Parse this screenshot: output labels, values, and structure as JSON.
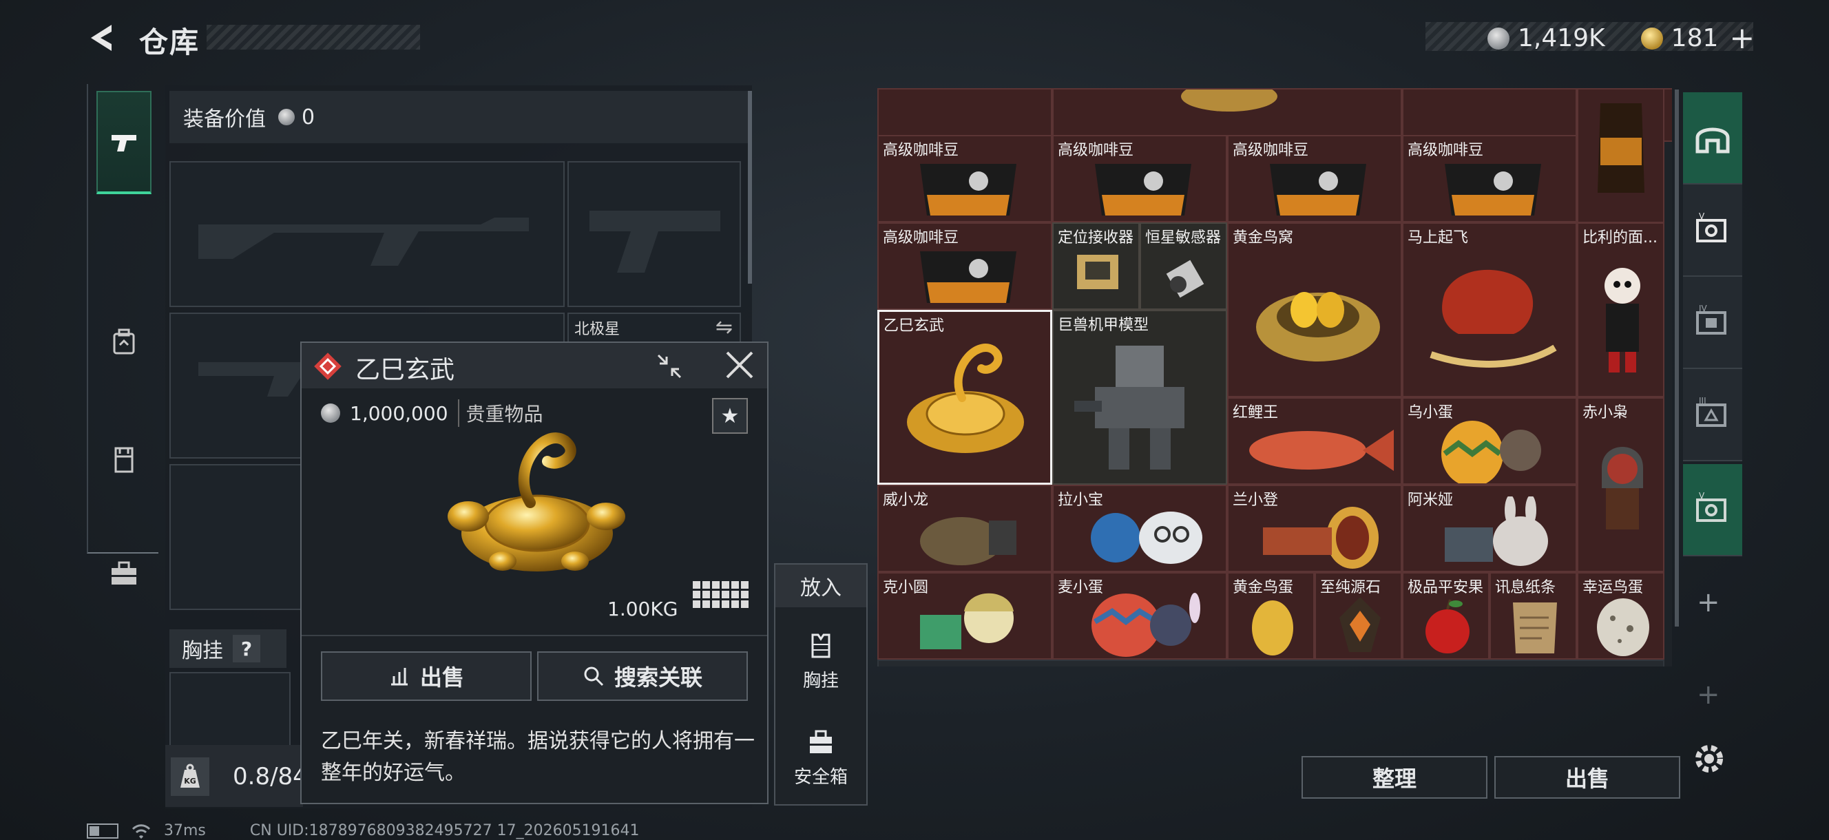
{
  "header": {
    "title": "仓库",
    "back_icon": "back-arrow-icon",
    "silver_amount": "1,419K",
    "gold_amount": "181",
    "add_label": "+"
  },
  "left_rail": {
    "items": [
      {
        "name": "weapons",
        "icon": "pistol-icon",
        "active": true
      },
      {
        "name": "armor",
        "icon": "backpack-icon",
        "active": false
      },
      {
        "name": "vest",
        "icon": "vest-icon",
        "active": false
      },
      {
        "name": "toolbox",
        "icon": "toolbox-icon",
        "active": false
      }
    ]
  },
  "equipment": {
    "value_label": "装备价值",
    "value": "0",
    "slot_label_northstar": "北极星",
    "chest_label": "胸挂",
    "chest_help": "?",
    "weight_icon_label": "KG",
    "weight_text": "0.8/84"
  },
  "item_popup": {
    "title": "乙巳玄武",
    "price": "1,000,000",
    "rarity": "贵重物品",
    "fav_icon": "★",
    "weight": "1.00KG",
    "sell_label": "出售",
    "search_label": "搜索关联",
    "description": "乙巳年关，新春祥瑞。据说获得它的人将拥有一整年的好运气。",
    "put_in_label": "放入",
    "put_in_options": [
      "胸挂",
      "安全箱"
    ]
  },
  "inventory": {
    "rows": [
      [
        "高级咖啡豆",
        "高级咖啡豆",
        "高级咖啡豆",
        "高级咖啡豆"
      ],
      [
        "高级咖啡豆",
        "定位接收器",
        "恒星敏感器",
        "黄金鸟窝",
        "马上起飞",
        "比利的面..."
      ],
      [
        "乙巳玄武",
        "巨兽机甲模型",
        "红鲤王",
        "乌小蛋",
        "赤小枭"
      ],
      [
        "威小龙",
        "拉小宝",
        "兰小登",
        "阿米娅"
      ],
      [
        "克小圆",
        "麦小蛋",
        "黄金鸟蛋",
        "至纯源石",
        "极品平安果",
        "讯息纸条",
        "幸运鸟蛋"
      ]
    ]
  },
  "bottom": {
    "organize_label": "整理",
    "sell_all_label": "出售"
  },
  "status": {
    "ping": "37ms",
    "uid": "CN UID:1878976809382495727 17_202605191641"
  }
}
